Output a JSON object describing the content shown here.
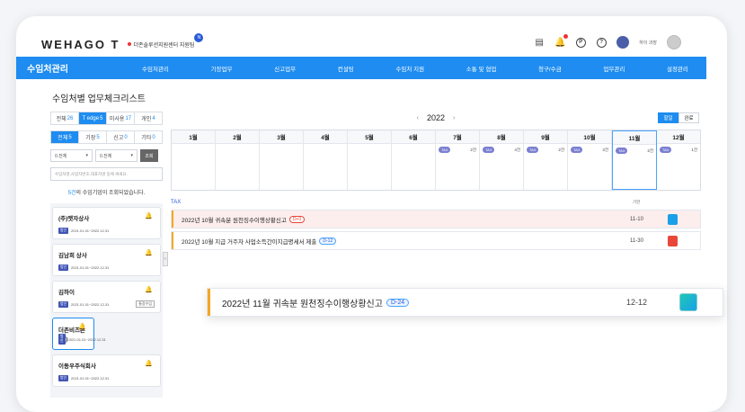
{
  "header": {
    "logo_text": "WEHAGO T",
    "org_name": "더존솔루션지원센터 지원팀",
    "org_badge": "N",
    "user_name": "하이 과장",
    "icons": [
      "document-icon",
      "bell-icon",
      "p-circle-icon",
      "help-icon",
      "user-avatar",
      "profile-avatar"
    ]
  },
  "nav": {
    "brand": "수임처관리",
    "menu": [
      "수임처관리",
      "기장업무",
      "신고업무",
      "컨설팅",
      "수임처 지원",
      "소통 및 협업",
      "청구/수금",
      "업무관리",
      "설정관리"
    ]
  },
  "page": {
    "title": "수임처별 업무체크리스트"
  },
  "left": {
    "tabs1": [
      {
        "label": "전체",
        "n": "26"
      },
      {
        "label": "T edge",
        "n": "5"
      },
      {
        "label": "미사용",
        "n": "17"
      },
      {
        "label": "개인",
        "n": "4"
      }
    ],
    "tabs2": [
      {
        "label": "전체",
        "n": "5"
      },
      {
        "label": "기장",
        "n": "5"
      },
      {
        "label": "신고",
        "n": "0"
      },
      {
        "label": "기타",
        "n": "0"
      }
    ],
    "select1": "0.전체",
    "select2": "0.전체",
    "query_btn": "조회",
    "search_placeholder": "수임처명,사업자번호,대표자명 등에 써세요.",
    "count_num": "5건",
    "count_text": "의 수임기업이 조회되었습니다.",
    "cards": [
      {
        "name": "(주)맷자상사",
        "badge": "법인",
        "period": "2021.01.01~2022.12.31",
        "tag": ""
      },
      {
        "name": "김남희 상사",
        "badge": "법인",
        "period": "2021.01.01~2022.12.31",
        "tag": ""
      },
      {
        "name": "김하이",
        "badge": "법인",
        "period": "2021.01.01~2022.12.31",
        "tag": "통장수임"
      },
      {
        "name": "더존비즈론(주)",
        "badge": "법인",
        "period": "2021.01.01~2022.12.31",
        "tag": ""
      },
      {
        "name": "이동우주식회사",
        "badge": "법인",
        "period": "2021.01.01~2022.12.31",
        "tag": ""
      }
    ]
  },
  "calendar": {
    "year": "2022",
    "view_buttons": [
      "할일",
      "완료"
    ],
    "months": [
      {
        "label": "1월",
        "pill": "",
        "count": ""
      },
      {
        "label": "2월",
        "pill": "",
        "count": ""
      },
      {
        "label": "3월",
        "pill": "",
        "count": ""
      },
      {
        "label": "4월",
        "pill": "",
        "count": ""
      },
      {
        "label": "5월",
        "pill": "",
        "count": ""
      },
      {
        "label": "6월",
        "pill": "",
        "count": ""
      },
      {
        "label": "7월",
        "pill": "TAX",
        "count": "2건"
      },
      {
        "label": "8월",
        "pill": "TAX",
        "count": "4건"
      },
      {
        "label": "9월",
        "pill": "TAX",
        "count": "2건"
      },
      {
        "label": "10월",
        "pill": "TAX",
        "count": "3건"
      },
      {
        "label": "11월",
        "pill": "TAX",
        "count": "2건"
      },
      {
        "label": "12월",
        "pill": "TAX",
        "count": "1건"
      }
    ]
  },
  "tasks": {
    "section": "TAX",
    "deadline_label": "기한",
    "items": [
      {
        "title": "2022년 10월 귀속분 원천징수이행상황신고",
        "dday": "D+0",
        "date": "11-10",
        "file_color": "#1aa0e8"
      },
      {
        "title": "2022년 10월 지급 거주자 사업소득간이지급명세서 제출",
        "dday": "D-12",
        "date": "11-30",
        "file_color": "#e8473a"
      }
    ],
    "highlight": {
      "title": "2022년 11월 귀속분 원천징수이행상황신고",
      "dday": "D-24",
      "date": "12-12"
    }
  }
}
